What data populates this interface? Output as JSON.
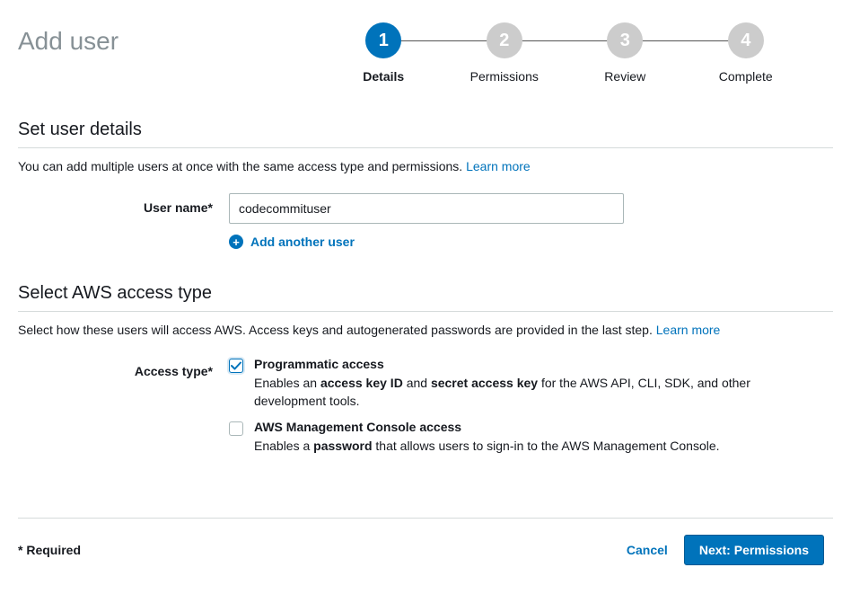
{
  "page_title": "Add user",
  "stepper": {
    "active": 1,
    "steps": [
      {
        "num": "1",
        "label": "Details"
      },
      {
        "num": "2",
        "label": "Permissions"
      },
      {
        "num": "3",
        "label": "Review"
      },
      {
        "num": "4",
        "label": "Complete"
      }
    ]
  },
  "user_details": {
    "title": "Set user details",
    "desc": "You can add multiple users at once with the same access type and permissions. ",
    "learn_more": "Learn more",
    "username_label": "User name*",
    "username_value": "codecommituser",
    "add_another": "Add another user"
  },
  "access_type": {
    "title": "Select AWS access type",
    "desc": "Select how these users will access AWS. Access keys and autogenerated passwords are provided in the last step. ",
    "learn_more": "Learn more",
    "label": "Access type*",
    "options": [
      {
        "checked": true,
        "title": "Programmatic access",
        "desc_prefix": "Enables an ",
        "desc_bold1": "access key ID",
        "desc_mid": " and ",
        "desc_bold2": "secret access key",
        "desc_suffix": " for the AWS API, CLI, SDK, and other development tools."
      },
      {
        "checked": false,
        "title": "AWS Management Console access",
        "desc_prefix": "Enables a ",
        "desc_bold1": "password",
        "desc_mid": "",
        "desc_bold2": "",
        "desc_suffix": " that allows users to sign-in to the AWS Management Console."
      }
    ]
  },
  "footer": {
    "required": "* Required",
    "cancel": "Cancel",
    "next": "Next: Permissions"
  }
}
